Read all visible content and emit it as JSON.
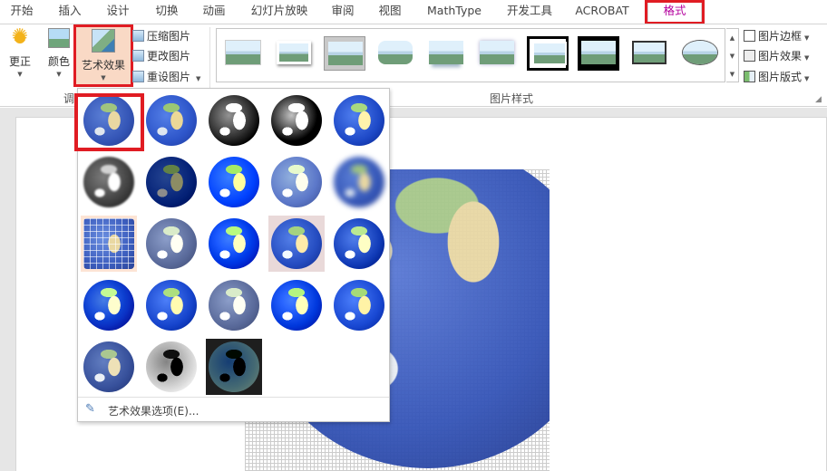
{
  "tabs": [
    {
      "label": "开始"
    },
    {
      "label": "插入"
    },
    {
      "label": "设计"
    },
    {
      "label": "切换"
    },
    {
      "label": "动画"
    },
    {
      "label": "幻灯片放映"
    },
    {
      "label": "审阅"
    },
    {
      "label": "视图"
    },
    {
      "label": "MathType"
    },
    {
      "label": "开发工具"
    },
    {
      "label": "ACROBAT"
    },
    {
      "label": "格式"
    }
  ],
  "active_tab": "格式",
  "adjust_group": {
    "label": "调",
    "corrections": "更正",
    "color": "颜色",
    "artistic_effects": "艺术效果",
    "compress": "压缩图片",
    "change": "更改图片",
    "reset": "重设图片"
  },
  "picture_styles_group": {
    "label": "图片样式",
    "border": "图片边框",
    "effects": "图片效果",
    "layout": "图片版式"
  },
  "art_effects_menu": {
    "options_label": "艺术效果选项(E)...",
    "effects_count": 23
  },
  "colors": {
    "highlight_red": "#e01c23",
    "active_tab_text": "#b4009e",
    "selected_tile": "#f9d9c5"
  }
}
